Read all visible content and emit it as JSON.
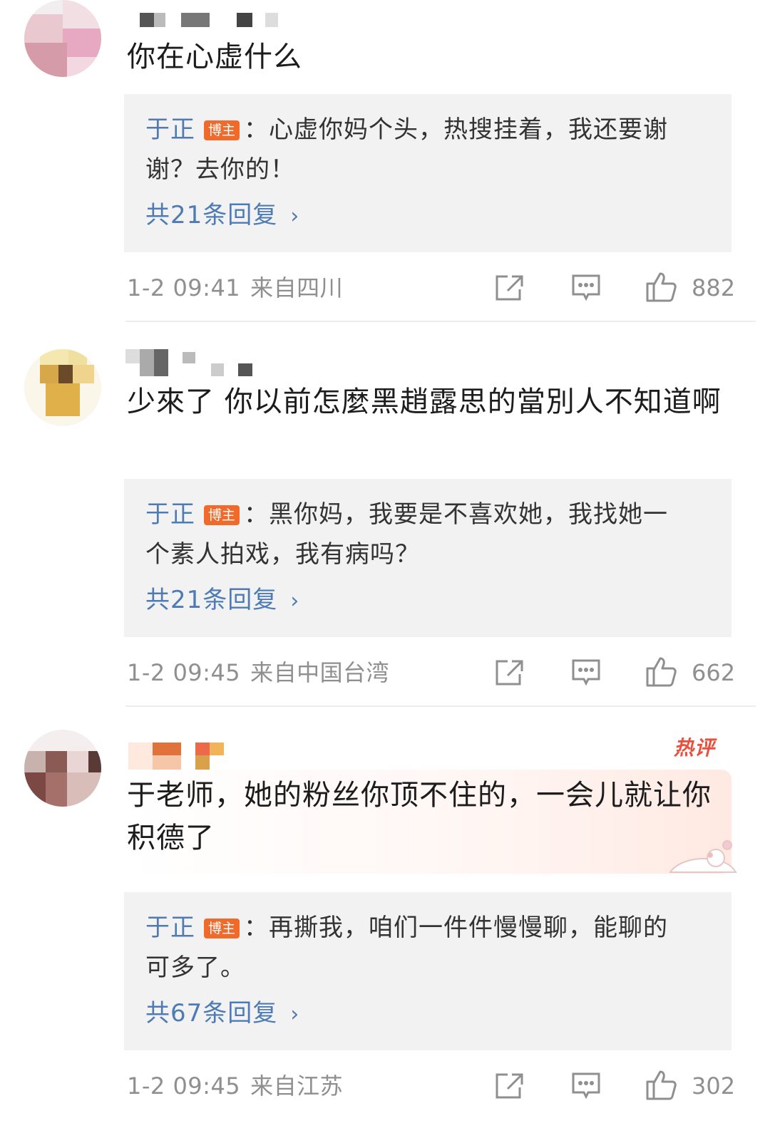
{
  "comments": [
    {
      "text": "你在心虚什么",
      "reply": {
        "author": "于正",
        "badge": "博主",
        "text": "：心虚你妈个头，热搜挂着，我还要谢谢？去你的！"
      },
      "more_replies": "共21条回复",
      "time": "1-2 09:41",
      "location": "来自四川",
      "likes": "882"
    },
    {
      "text": "少來了 你以前怎麼黑趙露思的當別人不知道啊",
      "reply": {
        "author": "于正",
        "badge": "博主",
        "text": "：黑你妈，我要是不喜欢她，我找她一个素人拍戏，我有病吗？"
      },
      "more_replies": "共21条回复",
      "time": "1-2 09:45",
      "location": "来自中国台湾",
      "likes": "662"
    },
    {
      "hot_label": "热评",
      "text": "于老师，她的粉丝你顶不住的，一会儿就让你积德了",
      "reply": {
        "author": "于正",
        "badge": "博主",
        "text": "：再撕我，咱们一件件慢慢聊，能聊的可多了。"
      },
      "more_replies": "共67条回复",
      "time": "1-2 09:45",
      "location": "来自江苏",
      "likes": "302"
    }
  ],
  "icons": {
    "repost": "repost-icon",
    "comment": "comment-icon",
    "like": "thumbs-up-icon",
    "chevron": "chevron-right-icon"
  },
  "colors": {
    "link_blue": "#4f7bb5",
    "badge_orange": "#f06a2b",
    "hot_red": "#e8513e",
    "meta_gray": "#8f8f8f",
    "reply_bg": "#f2f2f2"
  }
}
